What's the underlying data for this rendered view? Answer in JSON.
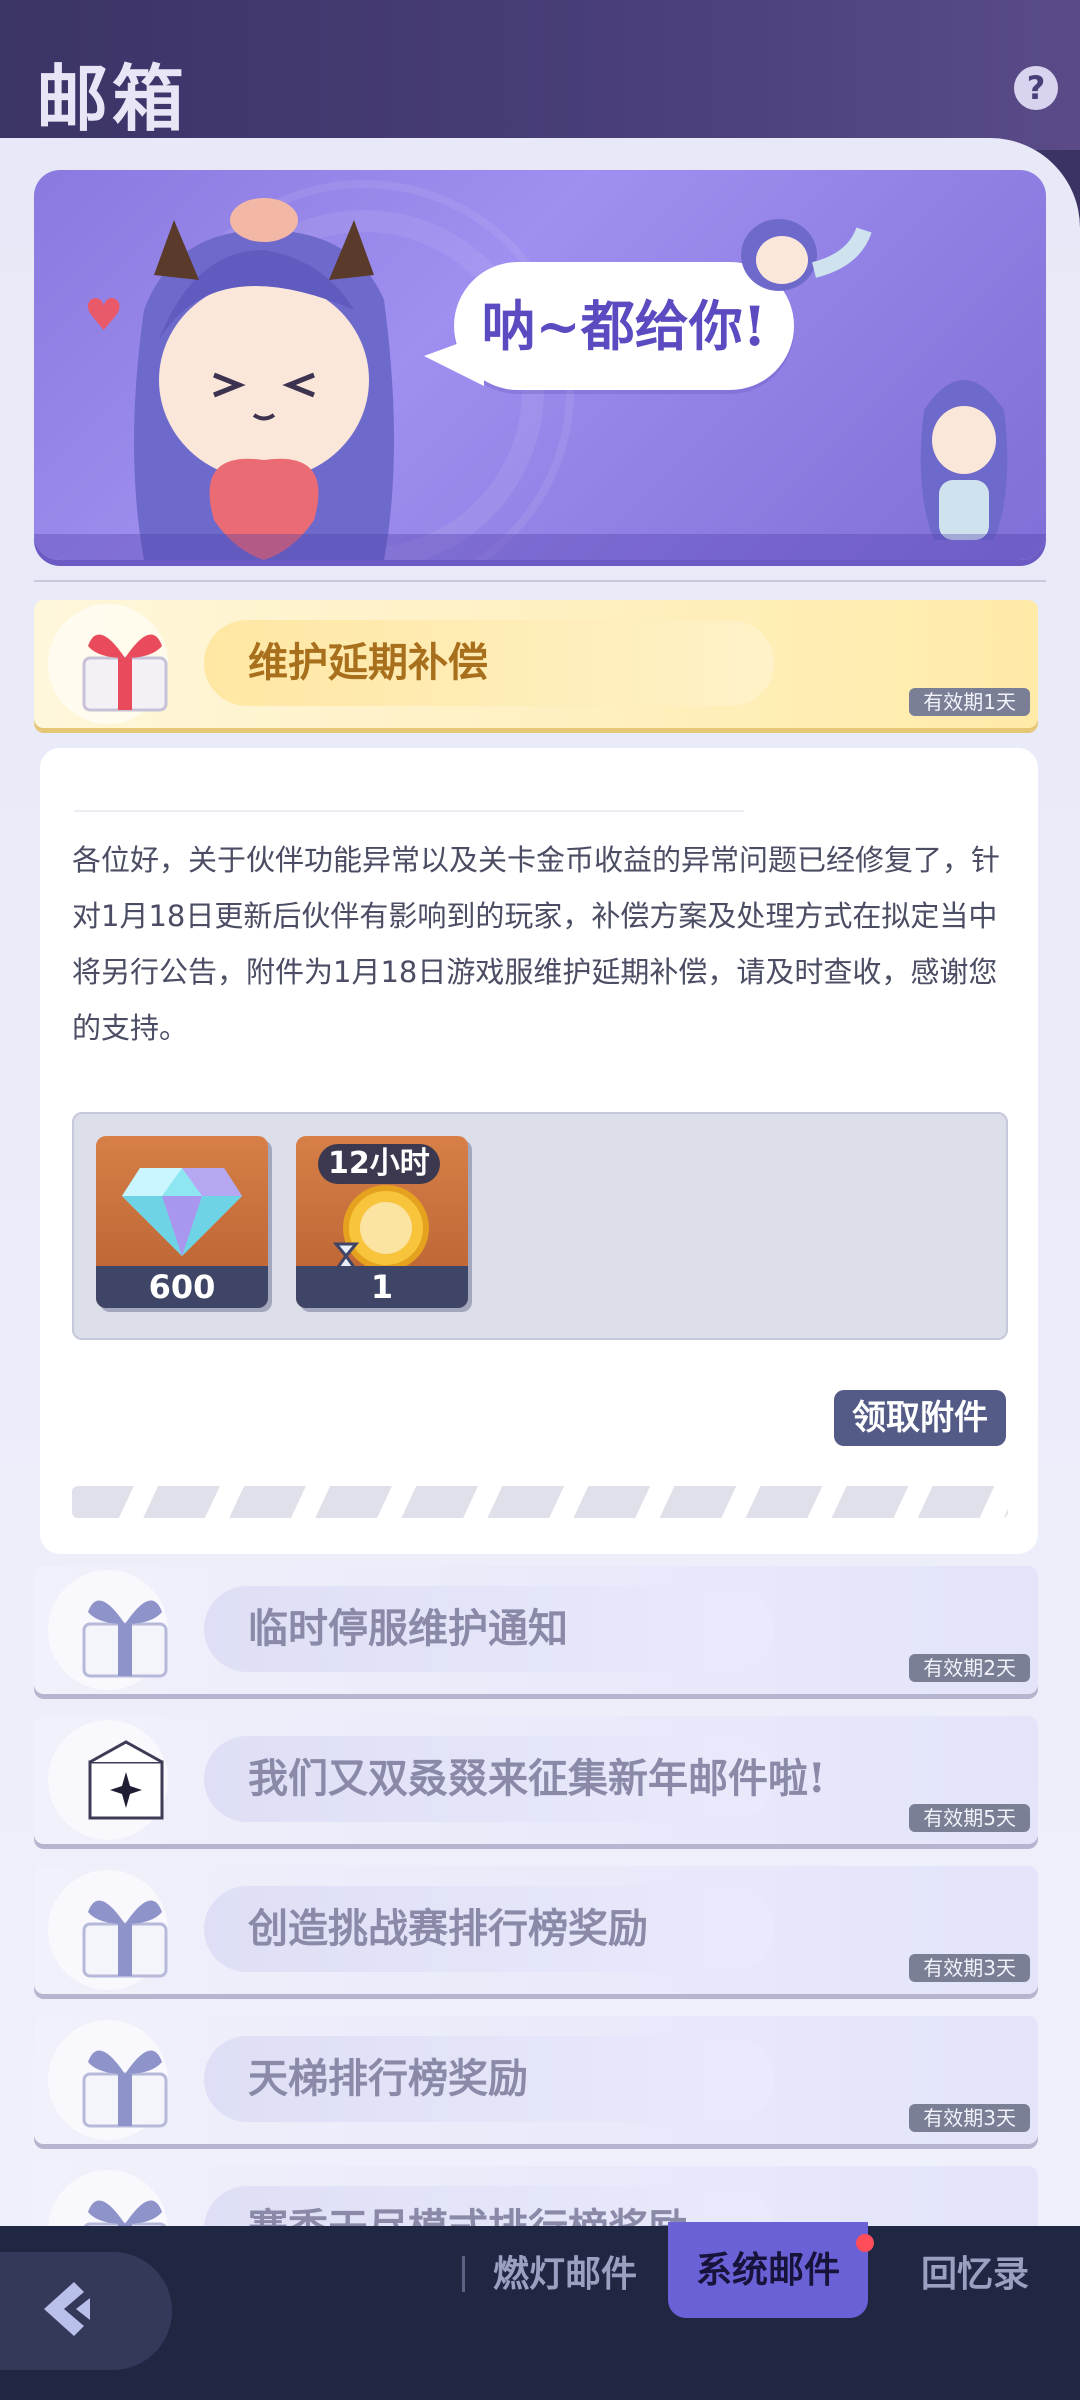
{
  "header": {
    "title": "邮箱",
    "help": "?"
  },
  "banner": {
    "speech": "呐~都给你!"
  },
  "active_mail": {
    "title": "维护延期补偿",
    "expiry": "有效期1天"
  },
  "detail": {
    "body": "各位好，关于伙伴功能异常以及关卡金币收益的异常问题已经修复了，针对1月18日更新后伙伴有影响到的玩家，补偿方案及处理方式在拟定当中将另行公告，附件为1月18日游戏服维护延期补偿，请及时查收，感谢您的支持。",
    "rewards": [
      {
        "name": "diamond",
        "count": "600"
      },
      {
        "name": "coin-boost",
        "tag": "12小时",
        "count": "1"
      }
    ],
    "claim_label": "领取附件"
  },
  "mails": [
    {
      "title": "临时停服维护通知",
      "expiry": "有效期2天",
      "icon": "gift-icon"
    },
    {
      "title": "我们又双叒叕来征集新年邮件啦!",
      "expiry": "有效期5天",
      "icon": "envelope-icon"
    },
    {
      "title": "创造挑战赛排行榜奖励",
      "expiry": "有效期3天",
      "icon": "gift-icon"
    },
    {
      "title": "天梯排行榜奖励",
      "expiry": "有效期3天",
      "icon": "gift-icon"
    },
    {
      "title": "赛季天尽模式排行榜奖励",
      "icon": "gift-icon"
    }
  ],
  "nav": {
    "tabs": [
      {
        "label": "燃灯邮件",
        "active": false
      },
      {
        "label": "系统邮件",
        "active": true
      },
      {
        "label": "回忆录",
        "active": false
      }
    ]
  },
  "colors": {
    "accent": "#6a61d6",
    "header_bg": "#3b3466",
    "gold": "#a8701c"
  }
}
